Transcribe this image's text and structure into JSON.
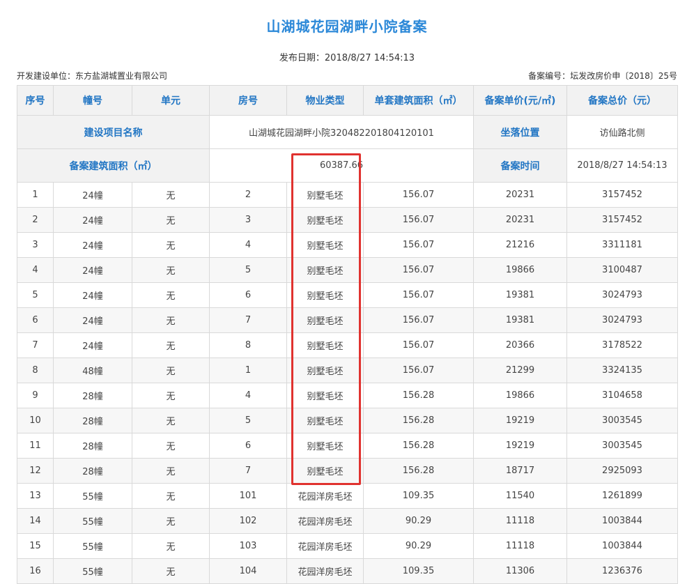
{
  "page": {
    "title": "山湖城花园湖畔小院备案",
    "publish_label": "发布日期：",
    "publish_date": "2018/8/27 14:54:13",
    "developer_label": "开发建设单位：",
    "developer": "东方盐湖城置业有限公司",
    "record_no_label": "备案编号：",
    "record_no": "坛发改房价申〔2018〕25号",
    "highlight_color": "#e0322f",
    "accent_color": "#2276c4"
  },
  "info": {
    "project_label": "建设项目名称",
    "project_value": "山湖城花园湖畔小院320482201804120101",
    "location_label": "坐落位置",
    "location_value": "访仙路北侧",
    "area_label": "备案建筑面积（㎡）",
    "area_value": "60387.66",
    "time_label": "备案时间",
    "time_value": "2018/8/27 14:54:13"
  },
  "table": {
    "headers": [
      "序号",
      "幢号",
      "单元",
      "房号",
      "物业类型",
      "单套建筑面积（㎡）",
      "备案单价(元/㎡)",
      "备案总价（元）"
    ],
    "rows": [
      [
        "1",
        "24幢",
        "无",
        "2",
        "别墅毛坯",
        "156.07",
        "20231",
        "3157452"
      ],
      [
        "2",
        "24幢",
        "无",
        "3",
        "别墅毛坯",
        "156.07",
        "20231",
        "3157452"
      ],
      [
        "3",
        "24幢",
        "无",
        "4",
        "别墅毛坯",
        "156.07",
        "21216",
        "3311181"
      ],
      [
        "4",
        "24幢",
        "无",
        "5",
        "别墅毛坯",
        "156.07",
        "19866",
        "3100487"
      ],
      [
        "5",
        "24幢",
        "无",
        "6",
        "别墅毛坯",
        "156.07",
        "19381",
        "3024793"
      ],
      [
        "6",
        "24幢",
        "无",
        "7",
        "别墅毛坯",
        "156.07",
        "19381",
        "3024793"
      ],
      [
        "7",
        "24幢",
        "无",
        "8",
        "别墅毛坯",
        "156.07",
        "20366",
        "3178522"
      ],
      [
        "8",
        "48幢",
        "无",
        "1",
        "别墅毛坯",
        "156.07",
        "21299",
        "3324135"
      ],
      [
        "9",
        "28幢",
        "无",
        "4",
        "别墅毛坯",
        "156.28",
        "19866",
        "3104658"
      ],
      [
        "10",
        "28幢",
        "无",
        "5",
        "别墅毛坯",
        "156.28",
        "19219",
        "3003545"
      ],
      [
        "11",
        "28幢",
        "无",
        "6",
        "别墅毛坯",
        "156.28",
        "19219",
        "3003545"
      ],
      [
        "12",
        "28幢",
        "无",
        "7",
        "别墅毛坯",
        "156.28",
        "18717",
        "2925093"
      ],
      [
        "13",
        "55幢",
        "无",
        "101",
        "花园洋房毛坯",
        "109.35",
        "11540",
        "1261899"
      ],
      [
        "14",
        "55幢",
        "无",
        "102",
        "花园洋房毛坯",
        "90.29",
        "11118",
        "1003844"
      ],
      [
        "15",
        "55幢",
        "无",
        "103",
        "花园洋房毛坯",
        "90.29",
        "11118",
        "1003844"
      ],
      [
        "16",
        "55幢",
        "无",
        "104",
        "花园洋房毛坯",
        "109.35",
        "11306",
        "1236376"
      ]
    ]
  }
}
